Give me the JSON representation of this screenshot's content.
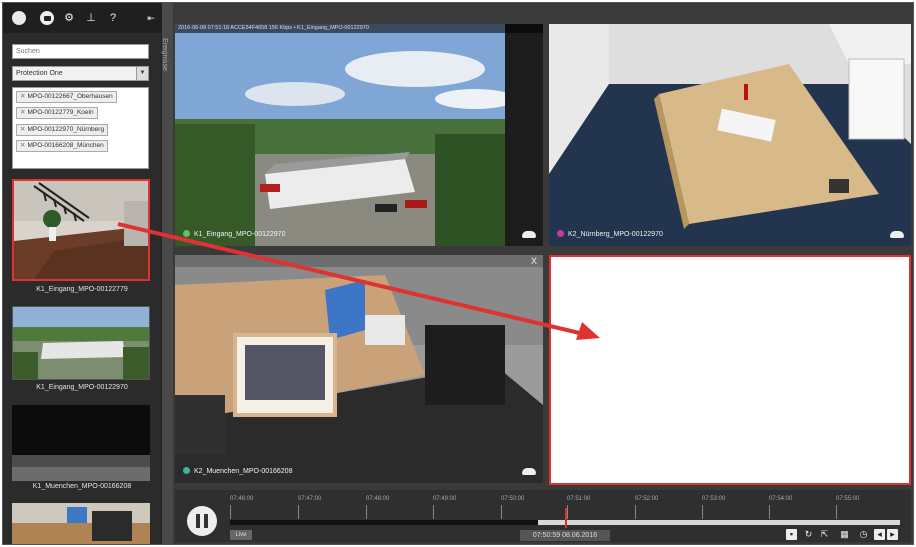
{
  "sidebar": {
    "search_placeholder": "Suchen",
    "location_select": "Protection One",
    "devices": [
      "MPO-00122667_Oberhausen",
      "MPO-00122779_Koeln",
      "MPO-00122970_Nürnberg",
      "MPO-00166208_München"
    ],
    "collapse_label": "Ereignisse",
    "thumbnails": [
      "K1_Eingang_MPO-00122779",
      "K1_Eingang_MPO-00122970",
      "K1_Muenchen_MPO-00166208"
    ]
  },
  "grid": {
    "tile1": {
      "label": "K1_Eingang_MPO-00122970",
      "osd": "2016-06-08  07:51:18  ACCE54F4658        156 Kbps  •  K1_Eingang_MPO-00122970",
      "dot_color": "#5ec46b"
    },
    "tile2": {
      "label": "K2_Nürnberg_MPO-00122970",
      "dot_color": "#c83aa3"
    },
    "tile3": {
      "label": "K2_Muenchen_MPO-00166208",
      "dot_color": "#3fb39a",
      "close": "X"
    }
  },
  "timeline": {
    "ticks": [
      "07:46:00",
      "07:47:00",
      "07:48:00",
      "07:49:00",
      "07:50:00",
      "07:51:00",
      "07:52:00",
      "07:53:00",
      "07:54:00",
      "07:55:00"
    ],
    "live_label": "Live",
    "current_time": "07:50:59 08.06.2016",
    "progress": 0.46
  },
  "colors": {
    "accent_red": "#e03232"
  },
  "icons": {
    "topbar": [
      "live-icon",
      "camera-icon",
      "gear-icon",
      "user-icon",
      "help-icon",
      "collapse-icon"
    ],
    "timeline": [
      "export-icon",
      "refresh-icon",
      "share-icon",
      "calendar-icon",
      "clock-icon",
      "prev-icon",
      "next-icon"
    ]
  }
}
